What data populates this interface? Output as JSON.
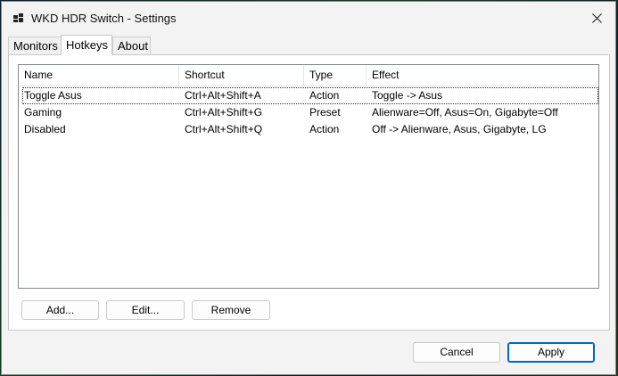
{
  "window": {
    "title": "WKD HDR Switch - Settings"
  },
  "tabs": [
    {
      "label": "Monitors",
      "active": false
    },
    {
      "label": "Hotkeys",
      "active": true
    },
    {
      "label": "About",
      "active": false
    }
  ],
  "hotkeys": {
    "columns": [
      "Name",
      "Shortcut",
      "Type",
      "Effect"
    ],
    "rows": [
      {
        "name": "Toggle Asus",
        "shortcut": "Ctrl+Alt+Shift+A",
        "type": "Action",
        "effect": "Toggle -> Asus",
        "selected": true
      },
      {
        "name": "Gaming",
        "shortcut": "Ctrl+Alt+Shift+G",
        "type": "Preset",
        "effect": "Alienware=Off, Asus=On, Gigabyte=Off",
        "selected": false
      },
      {
        "name": "Disabled",
        "shortcut": "Ctrl+Alt+Shift+Q",
        "type": "Action",
        "effect": "Off -> Alienware, Asus, Gigabyte, LG",
        "selected": false
      }
    ],
    "buttons": {
      "add": "Add...",
      "edit": "Edit...",
      "remove": "Remove"
    }
  },
  "footer": {
    "cancel": "Cancel",
    "apply": "Apply"
  },
  "icons": {
    "app": "app-grid-icon",
    "close": "close-icon"
  },
  "colors": {
    "accent": "#0067c0",
    "window_bg": "#f3f3f3"
  }
}
